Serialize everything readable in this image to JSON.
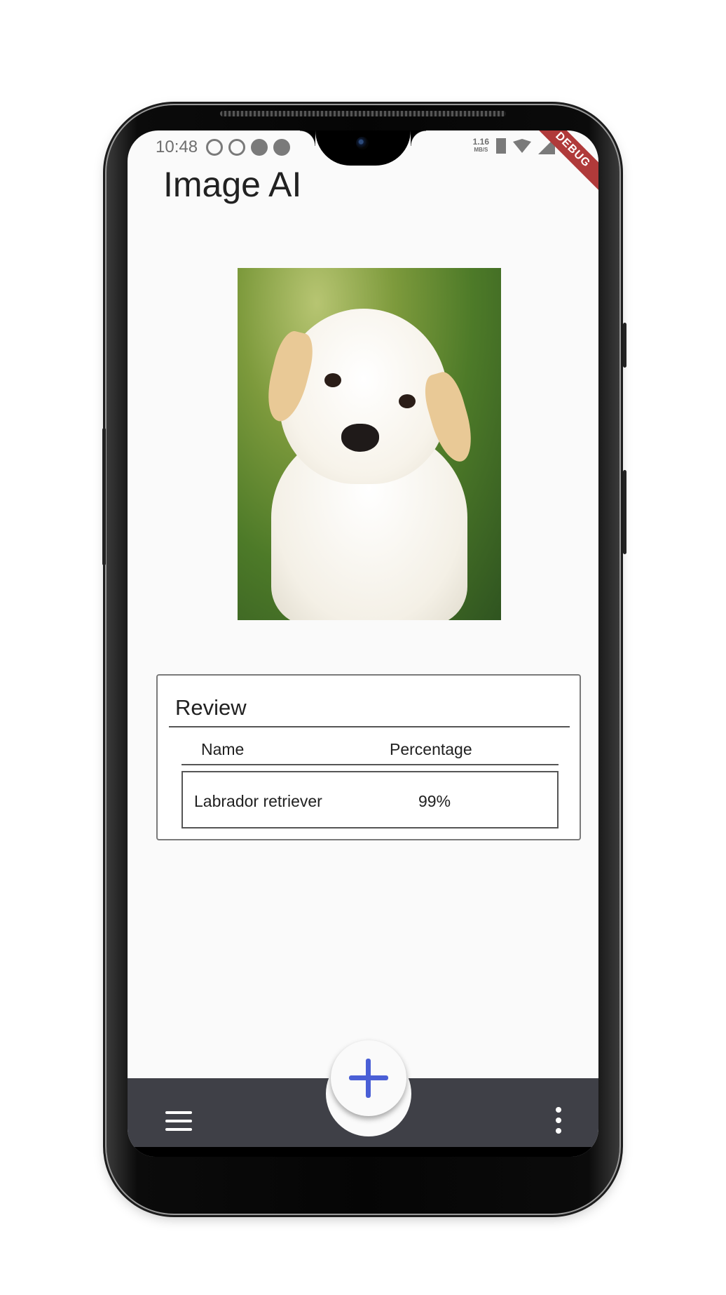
{
  "status_bar": {
    "time": "10:48",
    "net_speed_value": "1.16",
    "net_speed_unit": "MB/S",
    "debug_label": "DEBUG"
  },
  "app": {
    "title": "Image AI"
  },
  "review": {
    "title": "Review",
    "columns": [
      "Name",
      "Percentage"
    ],
    "rows": [
      {
        "name": "Labrador retriever",
        "percentage": "99%"
      }
    ]
  },
  "bottom_bar": {
    "fab_icon": "plus-icon",
    "menu_icon": "menu-icon",
    "more_icon": "more-vert-icon",
    "fab_color": "#4a5fd6",
    "bar_color": "#3f4047"
  }
}
